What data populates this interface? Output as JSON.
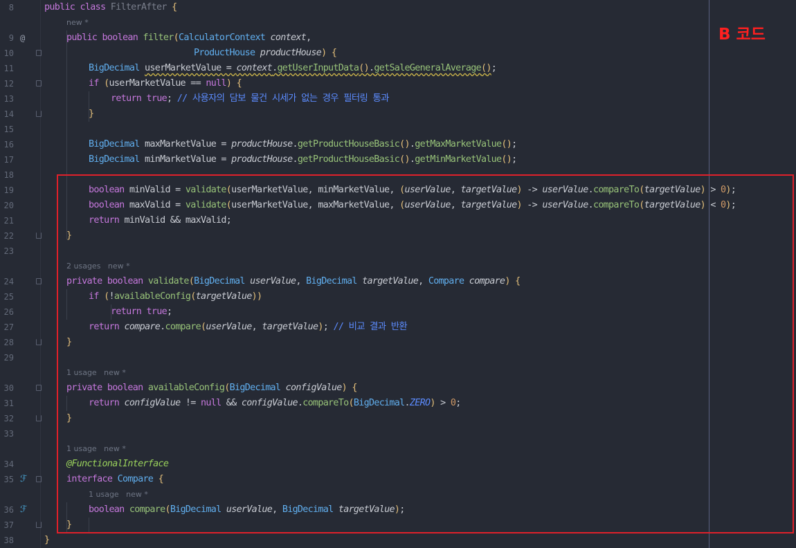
{
  "annotation": {
    "label": "B 코드"
  },
  "lines": [
    {
      "num": "8",
      "code": "public class FilterAfter {"
    },
    {
      "num": "9",
      "code": "public boolean filter(CalculatorContext context,"
    },
    {
      "num": "10",
      "code": "ProductHouse productHouse) {"
    },
    {
      "num": "11",
      "code": "BigDecimal userMarketValue = context.getUserInputData().getSaleGeneralAverage();"
    },
    {
      "num": "12",
      "code": "if (userMarketValue == null) {"
    },
    {
      "num": "13",
      "code": "return true; // 사용자의 담보 물건 시세가 없는 경우 필터링 통과"
    },
    {
      "num": "14",
      "code": "}"
    },
    {
      "num": "15",
      "code": ""
    },
    {
      "num": "16",
      "code": "BigDecimal maxMarketValue = productHouse.getProductHouseBasic().getMaxMarketValue();"
    },
    {
      "num": "17",
      "code": "BigDecimal minMarketValue = productHouse.getProductHouseBasic().getMinMarketValue();"
    },
    {
      "num": "18",
      "code": ""
    },
    {
      "num": "19",
      "code": "boolean minValid = validate(userMarketValue, minMarketValue, (userValue, targetValue) -> userValue.compareTo(targetValue) > 0);"
    },
    {
      "num": "20",
      "code": "boolean maxValid = validate(userMarketValue, maxMarketValue, (userValue, targetValue) -> userValue.compareTo(targetValue) < 0);"
    },
    {
      "num": "21",
      "code": "return minValid && maxValid;"
    },
    {
      "num": "22",
      "code": "}"
    },
    {
      "num": "23",
      "code": ""
    },
    {
      "num": "24",
      "code": "private boolean validate(BigDecimal userValue, BigDecimal targetValue, Compare compare) {"
    },
    {
      "num": "25",
      "code": "if (!availableConfig(targetValue))"
    },
    {
      "num": "26",
      "code": "return true;"
    },
    {
      "num": "27",
      "code": "return compare.compare(userValue, targetValue); // 비교 결과 반환"
    },
    {
      "num": "28",
      "code": "}"
    },
    {
      "num": "29",
      "code": ""
    },
    {
      "num": "30",
      "code": "private boolean availableConfig(BigDecimal configValue) {"
    },
    {
      "num": "31",
      "code": "return configValue != null && configValue.compareTo(BigDecimal.ZERO) > 0;"
    },
    {
      "num": "32",
      "code": "}"
    },
    {
      "num": "33",
      "code": ""
    },
    {
      "num": "34",
      "code": "@FunctionalInterface"
    },
    {
      "num": "35",
      "code": "interface Compare {"
    },
    {
      "num": "36",
      "code": "boolean compare(BigDecimal userValue, BigDecimal targetValue);"
    },
    {
      "num": "37",
      "code": "}"
    },
    {
      "num": "38",
      "code": "}"
    }
  ],
  "hints": {
    "h9": "new *",
    "h24": "2 usages   new *",
    "h30": "1 usage   new *",
    "h34": "1 usage   new *",
    "h36": "1 usage   new *"
  },
  "gutter_icons": {
    "line9": "@",
    "line35": "implementation-run-icon",
    "line36": "implementation-run-icon"
  },
  "colors": {
    "background": "#262a34",
    "keyword": "#c678dd",
    "type": "#61afef",
    "method": "#98c379",
    "comment": "#5c8cff",
    "annotation_box": "#e0202a"
  }
}
